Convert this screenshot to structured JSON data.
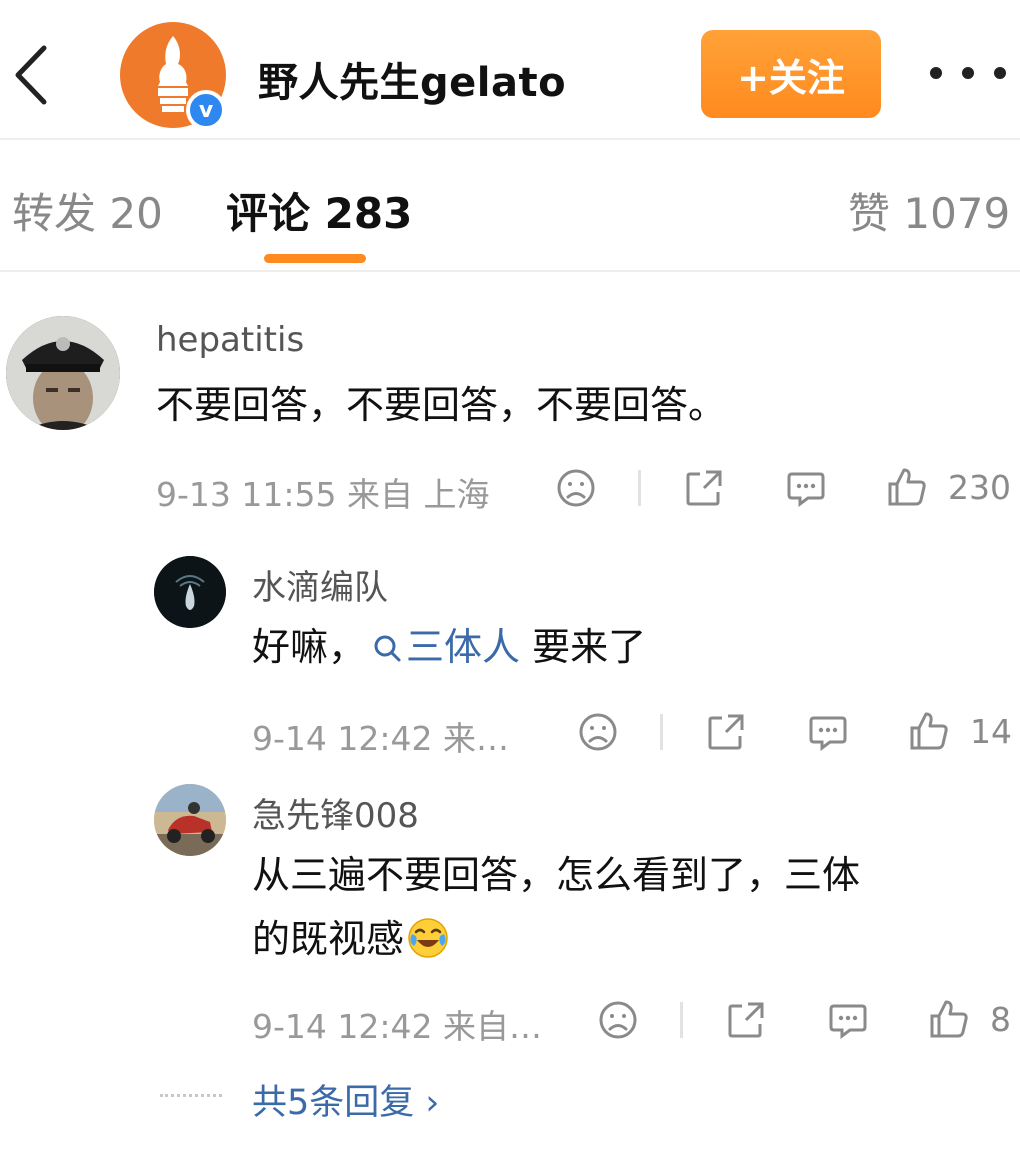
{
  "header": {
    "username": "野人先生gelato",
    "follow_label": "+关注"
  },
  "tabs": [
    {
      "label": "转发 20"
    },
    {
      "label": "评论 283"
    },
    {
      "label": "赞 1079"
    }
  ],
  "comments": [
    {
      "user": "hepatitis",
      "text": "不要回答，不要回答，不要回答。",
      "meta": "9-13 11:55 来自 上海",
      "likes": "230"
    },
    {
      "user": "水滴编队",
      "text_before": "好嘛，",
      "topic_link": "三体人",
      "text_after": " 要来了",
      "meta": "9-14 12:42 来…",
      "likes": "14"
    },
    {
      "user": "急先锋008",
      "text_line1": "从三遍不要回答，怎么看到了，三体",
      "text_line2": "的既视感",
      "meta": "9-14 12:42 来自…",
      "likes": "8"
    }
  ],
  "more_replies_label": "共5条回复 ›",
  "colors": {
    "accent_orange": "#ff8a1f",
    "link_blue": "#3a6aa8",
    "verified_blue": "#2e88f0"
  },
  "icons": [
    "back-arrow-icon",
    "verified-icon",
    "more-icon",
    "dislike-face-icon",
    "share-icon",
    "comment-icon",
    "thumbs-up-icon",
    "search-icon",
    "laughing-cry-emoji",
    "chevron-right-icon"
  ]
}
